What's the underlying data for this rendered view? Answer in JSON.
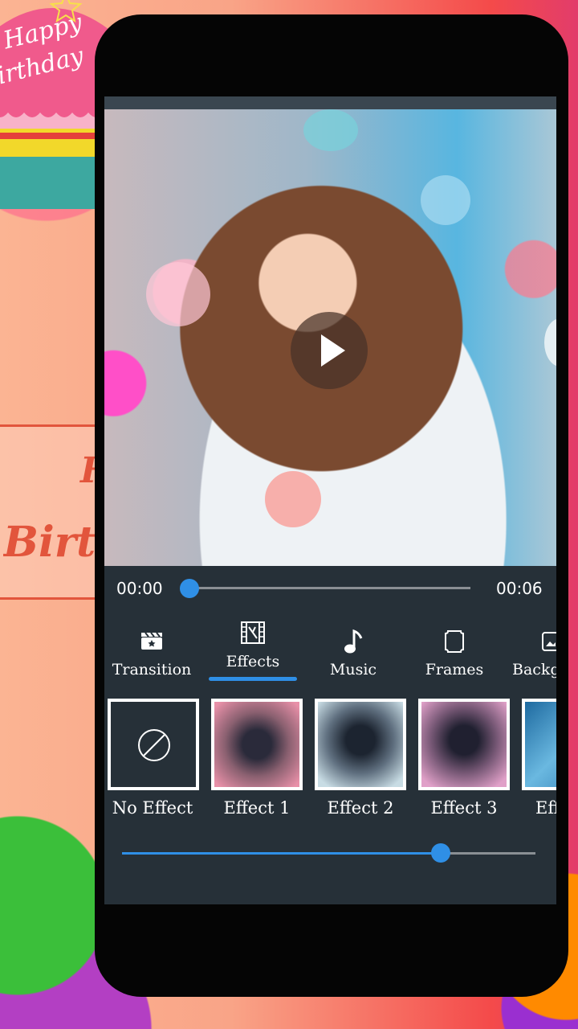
{
  "player": {
    "current_time": "00:00",
    "total_time": "00:06",
    "progress_fraction": 0.0
  },
  "tabs": [
    {
      "label": "Transition",
      "icon": "clapperboard-icon",
      "selected": false
    },
    {
      "label": "Effects",
      "icon": "film-effects-icon",
      "selected": true
    },
    {
      "label": "Music",
      "icon": "music-note-icon",
      "selected": false
    },
    {
      "label": "Frames",
      "icon": "frame-icon",
      "selected": false
    },
    {
      "label": "Backg",
      "icon": "background-icon",
      "selected": false
    }
  ],
  "effects": [
    {
      "label": "No Effect",
      "selected": true
    },
    {
      "label": "Effect 1",
      "selected": false
    },
    {
      "label": "Effect 2",
      "selected": false
    },
    {
      "label": "Effect 3",
      "selected": false
    },
    {
      "label": "Eff",
      "selected": false
    }
  ],
  "intensity_fraction": 0.77,
  "background_text": {
    "cake_top": "Happy",
    "cake_bottom": "irthday",
    "banner_word": "Birth",
    "banner_letter": "H"
  },
  "colors": {
    "accent": "#2f8fe6",
    "panel": "#263038"
  }
}
